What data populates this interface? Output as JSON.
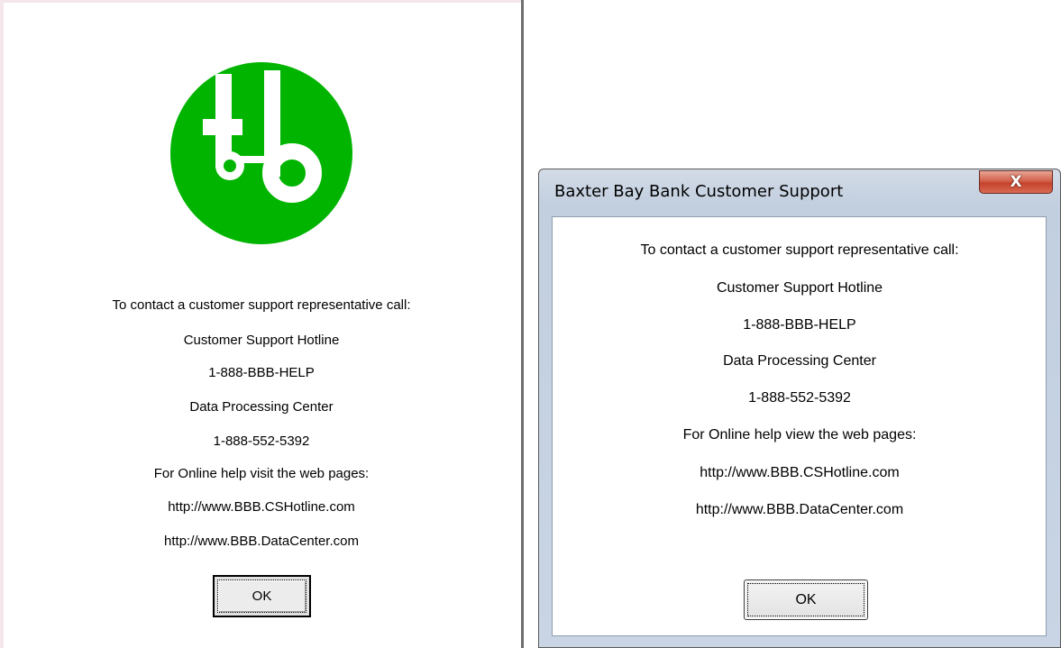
{
  "left": {
    "lines": [
      "To contact a customer support representative call:",
      "Customer Support Hotline",
      "1-888-BBB-HELP",
      "Data Processing Center",
      "1-888-552-5392",
      "For Online help visit the web pages:",
      "http://www.BBB.CSHotline.com",
      "http://www.BBB.DataCenter.com"
    ],
    "ok_label": "OK",
    "logo_icon": "bbb-logo-icon",
    "logo_color": "#00b400"
  },
  "right": {
    "title": "Baxter Bay Bank Customer Support",
    "close_label": "X",
    "lines": [
      "To contact a customer support representative call:",
      "Customer Support Hotline",
      "1-888-BBB-HELP",
      "Data Processing Center",
      "1-888-552-5392",
      "For Online help view the web pages:",
      "http://www.BBB.CSHotline.com",
      "http://www.BBB.DataCenter.com"
    ],
    "ok_label": "OK"
  }
}
